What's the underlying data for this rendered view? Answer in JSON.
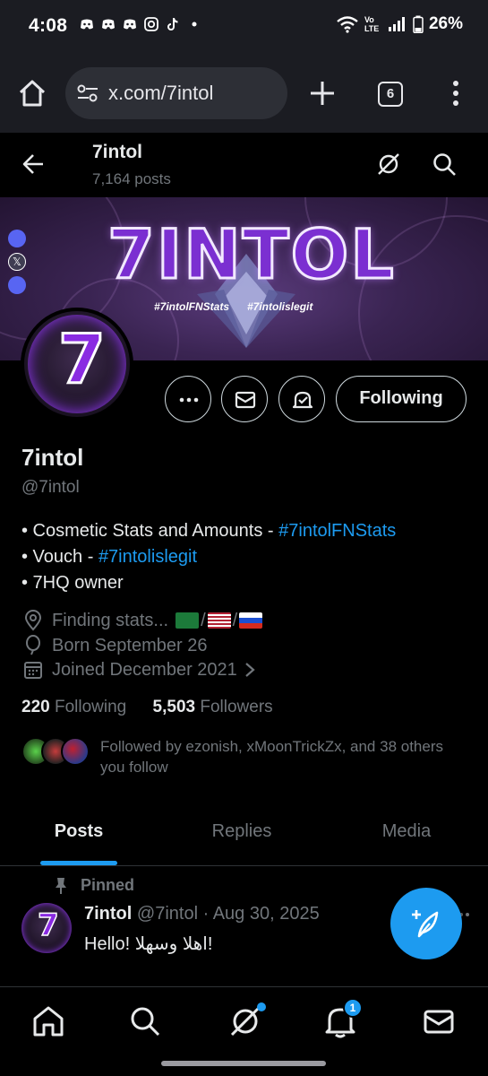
{
  "status_bar": {
    "time": "4:08",
    "network": "Vo LTE",
    "battery": "26%"
  },
  "browser": {
    "url": "x.com/7intol",
    "tab_count": "6"
  },
  "header": {
    "name": "7intol",
    "post_count": "7,164 posts"
  },
  "banner": {
    "logo_text": "7INTOL",
    "tag1": "#7intolFNStats",
    "tag2": "#7intolislegit"
  },
  "actions": {
    "following_label": "Following"
  },
  "profile": {
    "name": "7intol",
    "handle": "@7intol",
    "bio_line1_prefix": "• Cosmetic Stats and Amounts - ",
    "bio_line1_link": "#7intolFNStats",
    "bio_line2_prefix": "• Vouch - ",
    "bio_line2_link": "#7intolislegit",
    "bio_line3": "• 7HQ owner",
    "location": "Finding stats...",
    "birthday": "Born September 26",
    "joined": "Joined December 2021",
    "following_count": "220",
    "following_label": "Following",
    "followers_count": "5,503",
    "followers_label": "Followers",
    "followed_by": "Followed by ezonish, xMoonTrickZx, and 38 others you follow"
  },
  "tabs": [
    "Posts",
    "Replies",
    "Media"
  ],
  "pinned_post": {
    "pinned_label": "Pinned",
    "author": "7intol",
    "handle_date": "@7intol · Aug 30, 2025",
    "text": "Hello! اهلا وسهلا!"
  },
  "bottom_nav": {
    "notification_badge": "1"
  },
  "colors": {
    "accent": "#1d9bf0",
    "background": "#000000",
    "secondary_text": "#71767b"
  }
}
